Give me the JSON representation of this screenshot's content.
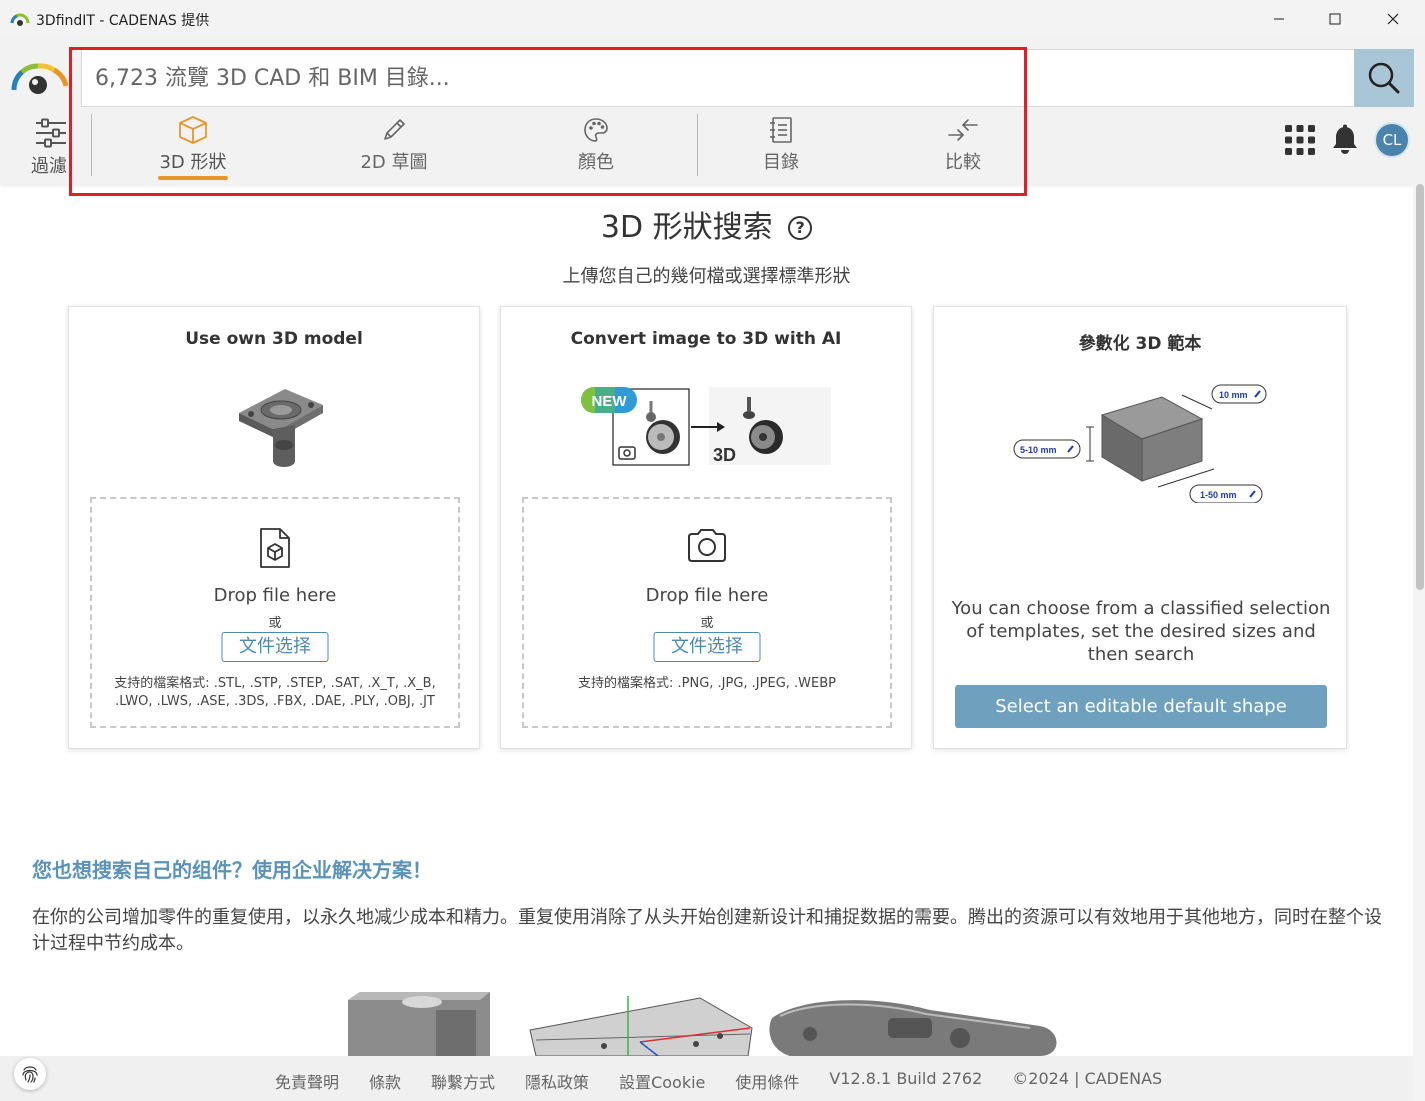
{
  "window": {
    "title": "3DfindIT - CADENAS 提供",
    "minimize_icon": "minimize-icon",
    "maximize_icon": "maximize-icon",
    "close_icon": "close-icon"
  },
  "header": {
    "search": {
      "placeholder": "6,723 流覽 3D CAD 和 BIM 目錄..."
    },
    "filter_label": "過濾",
    "tabs": [
      {
        "label": "3D 形狀",
        "icon": "cube-icon",
        "active": true
      },
      {
        "label": "2D 草圖",
        "icon": "pencil-icon",
        "active": false
      },
      {
        "label": "顏色",
        "icon": "palette-icon",
        "active": false
      },
      {
        "label": "目錄",
        "icon": "catalog-icon",
        "active": false
      },
      {
        "label": "比較",
        "icon": "compare-arrows-icon",
        "active": false
      }
    ],
    "avatar_initials": "CL",
    "accent_color": "#e8962a",
    "highlight_color": "#e01e2a"
  },
  "main": {
    "title": "3D 形狀搜索",
    "help_glyph": "?",
    "subtitle": "上傳您自己的幾何檔或選擇標準形狀",
    "cards": [
      {
        "title": "Use own 3D model",
        "drop_text": "Drop file here",
        "or_text": "或",
        "button": "文件选择",
        "formats": "支持的檔案格式: .STL, .STP, .STEP, .SAT, .X_T, .X_B, .LWO, .LWS, .ASE, .3DS, .FBX, .DAE, .PLY, .OBJ, .JT"
      },
      {
        "title": "Convert image to 3D with AI",
        "badge": "NEW",
        "label_3d": "3D",
        "drop_text": "Drop file here",
        "or_text": "或",
        "button": "文件选择",
        "formats": "支持的檔案格式: .PNG, .JPG, .JPEG, .WEBP"
      },
      {
        "title": "參數化 3D 範本",
        "dim_labels": [
          "10 mm",
          "5-10 mm",
          "1-50 mm"
        ],
        "description": "You can choose from a classified selection of templates, set the desired sizes and then search",
        "button": "Select an editable default shape"
      }
    ],
    "promo": {
      "title": "您也想搜索自己的组件？使用企业解决方案！",
      "text": "在你的公司增加零件的重复使用，以永久地减少成本和精力。重复使用消除了从头开始创建新设计和捕捉数据的需要。腾出的资源可以有效地用于其他地方，同时在整个设计过程中节约成本。"
    }
  },
  "footer": {
    "links": [
      "免責聲明",
      "條款",
      "聯繫方式",
      "隱私政策",
      "設置Cookie",
      "使用條件"
    ],
    "version": "V12.8.1 Build 2762",
    "copyright": "©2024 | CADENAS"
  }
}
